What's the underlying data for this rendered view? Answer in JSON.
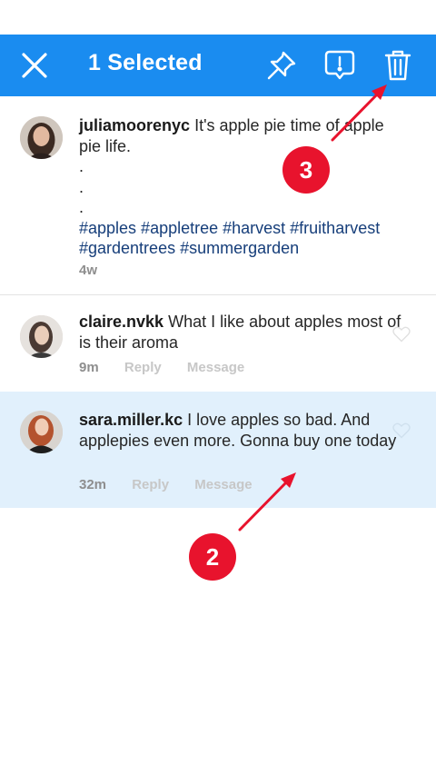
{
  "topbar": {
    "title": "1 Selected",
    "icons": [
      "close-icon",
      "pin-icon",
      "report-icon",
      "trash-icon"
    ]
  },
  "comments": [
    {
      "username": "juliamoorenyc",
      "text": "It's apple pie time of apple pie life.",
      "dots": [
        ".",
        ".",
        "."
      ],
      "hashtags": "#apples #appletree #harvest #fruitharvest #gardentrees #summergarden",
      "time": "4w"
    },
    {
      "username": "claire.nvkk",
      "text": "What I like about apples most of is their aroma",
      "time": "9m",
      "reply": "Reply",
      "message": "Message"
    },
    {
      "username": "sara.miller.kc",
      "text": "I love apples so bad. And applepies even more. Gonna buy one today",
      "time": "32m",
      "reply": "Reply",
      "message": "Message",
      "selected": true
    }
  ],
  "annotations": {
    "step_2": "2",
    "step_3": "3",
    "color": "#e8132d"
  },
  "colors": {
    "accent": "#1a8cf0",
    "selected_row": "#e1f0fc",
    "hashtag": "#163e7a"
  }
}
